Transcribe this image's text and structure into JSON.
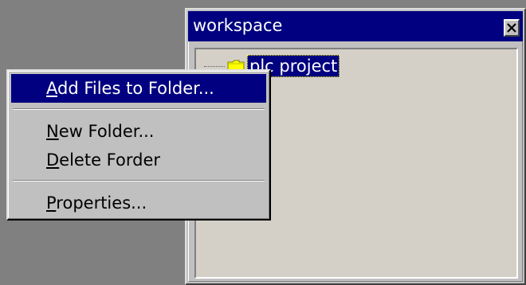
{
  "window": {
    "title": "workspace",
    "close_icon": "close-x-icon"
  },
  "tree": {
    "items": [
      {
        "label": "plc project",
        "icon": "folder-icon"
      }
    ]
  },
  "context_menu": {
    "items": [
      {
        "mnemonic": "A",
        "rest": "dd Files to Folder...",
        "highlighted": true
      },
      {
        "mnemonic": "N",
        "rest": "ew Folder..."
      },
      {
        "mnemonic": "D",
        "rest": "elete Forder"
      },
      {
        "mnemonic": "P",
        "rest": "roperties..."
      }
    ]
  },
  "colors": {
    "titlebar": "#000080",
    "highlight": "#000080",
    "face": "#c0c0c0",
    "panel": "#d4d0c8",
    "desktop": "#808080"
  }
}
